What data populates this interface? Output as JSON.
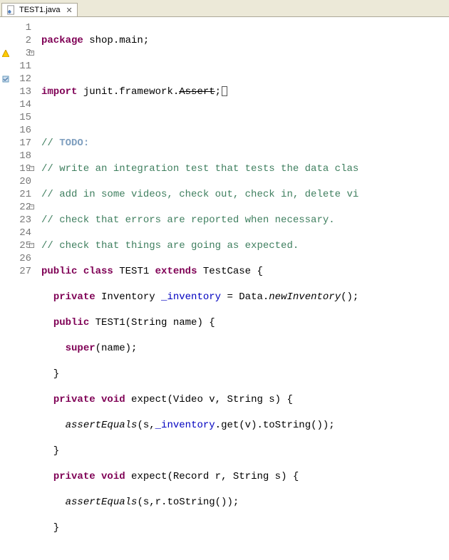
{
  "tab": {
    "filename": "TEST1.java"
  },
  "gutter": [
    "1",
    "2",
    "3",
    "11",
    "12",
    "13",
    "14",
    "15",
    "16",
    "17",
    "18",
    "19",
    "20",
    "21",
    "22",
    "23",
    "24",
    "25",
    "26",
    "27"
  ],
  "lines": {
    "l1": {
      "kw1": "package",
      "rest": " shop.main;"
    },
    "l2": "",
    "l3": {
      "kw1": "import",
      "rest1": " junit.framework.",
      "strike": "Assert",
      "rest2": ";"
    },
    "l4": "",
    "l5": {
      "cm1": "// ",
      "tag": "TODO:"
    },
    "l6": "// write an integration test that tests the data clas",
    "l7": "// add in some videos, check out, check in, delete vi",
    "l8": "// check that errors are reported when necessary.",
    "l9": "// check that things are going as expected.",
    "l10": {
      "kw1": "public",
      "kw2": "class",
      "cls": " TEST1 ",
      "kw3": "extends",
      "sup": " TestCase {"
    },
    "l11": {
      "kw1": "private",
      "type": " Inventory ",
      "fld": "_inventory",
      "eq": " = Data.",
      "call": "newInventory",
      "end": "();"
    },
    "l12": {
      "kw1": "public",
      "name": " TEST1(String name) {"
    },
    "l13": {
      "kw1": "super",
      "rest": "(name);"
    },
    "l14": "  }",
    "l15": {
      "kw1": "private",
      "kw2": "void",
      "name": " expect(Video v, String s) {"
    },
    "l16": {
      "call1": "assertEquals",
      "p1": "(s,",
      "fld": "_inventory",
      "p2": ".get(v).toString());"
    },
    "l17": "  }",
    "l18": {
      "kw1": "private",
      "kw2": "void",
      "name": " expect(Record r, String s) {"
    },
    "l19": {
      "call1": "assertEquals",
      "p1": "(s,r.toString());"
    },
    "l20": "  }"
  }
}
